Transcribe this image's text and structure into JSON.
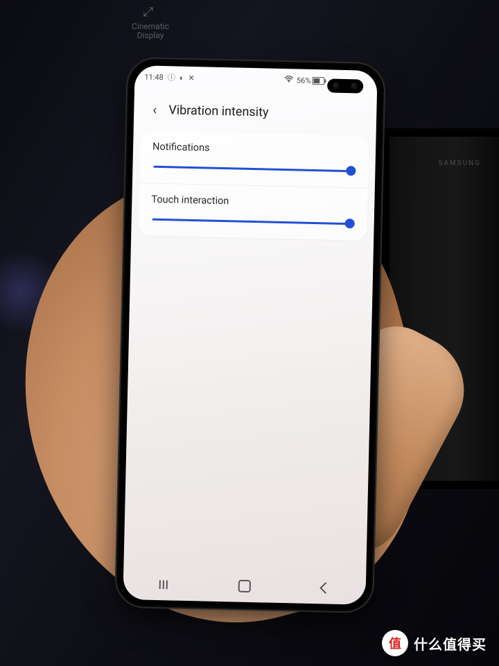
{
  "booth_sign": {
    "line1": "Cinematic",
    "line2": "Display"
  },
  "tablet_logo": "SAMSUNG",
  "status": {
    "time": "11:48",
    "left_icon1": "ⓘ",
    "left_icon2": "◐",
    "left_icon3": "✕",
    "wifi_icon": "wifi-icon",
    "battery_pct": "56%",
    "battery_icon": "battery-icon"
  },
  "header": {
    "back_glyph": "‹",
    "title": "Vibration intensity"
  },
  "settings": [
    {
      "label": "Notifications",
      "value": 100
    },
    {
      "label": "Touch interaction",
      "value": 100
    }
  ],
  "nav": {
    "recents": "recents-button",
    "home": "home-button",
    "back": "back-button"
  },
  "watermark": {
    "badge": "值",
    "text": "什么值得买"
  },
  "colors": {
    "accent": "#2150d5"
  }
}
